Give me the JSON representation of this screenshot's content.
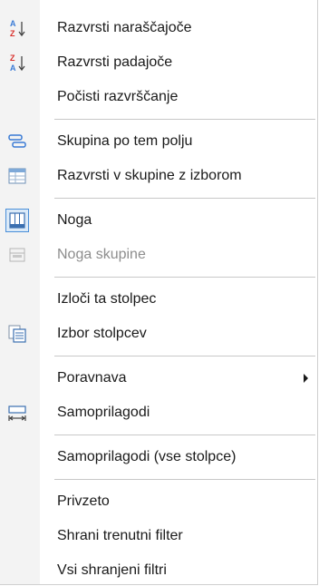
{
  "menu": {
    "items": [
      {
        "label": "Razvrsti naraščajoče"
      },
      {
        "label": "Razvrsti padajoče"
      },
      {
        "label": "Počisti razvrščanje"
      },
      {
        "label": "Skupina po tem polju"
      },
      {
        "label": "Razvrsti v skupine z izborom"
      },
      {
        "label": "Noga"
      },
      {
        "label": "Noga skupine"
      },
      {
        "label": "Izloči ta stolpec"
      },
      {
        "label": "Izbor stolpcev"
      },
      {
        "label": "Poravnava"
      },
      {
        "label": "Samoprilagodi"
      },
      {
        "label": "Samoprilagodi (vse stolpce)"
      },
      {
        "label": "Privzeto"
      },
      {
        "label": "Shrani trenutni filter"
      },
      {
        "label": "Vsi shranjeni filtri"
      }
    ],
    "icon_glyphs": {
      "sort_az": [
        "A",
        "Z"
      ],
      "sort_za": [
        "Z",
        "A"
      ]
    },
    "colors": {
      "icon_blue": "#3a7bd5",
      "icon_red": "#d9302c",
      "disabled_text": "#8d8d8d",
      "gutter": "#f3f3f3"
    }
  }
}
